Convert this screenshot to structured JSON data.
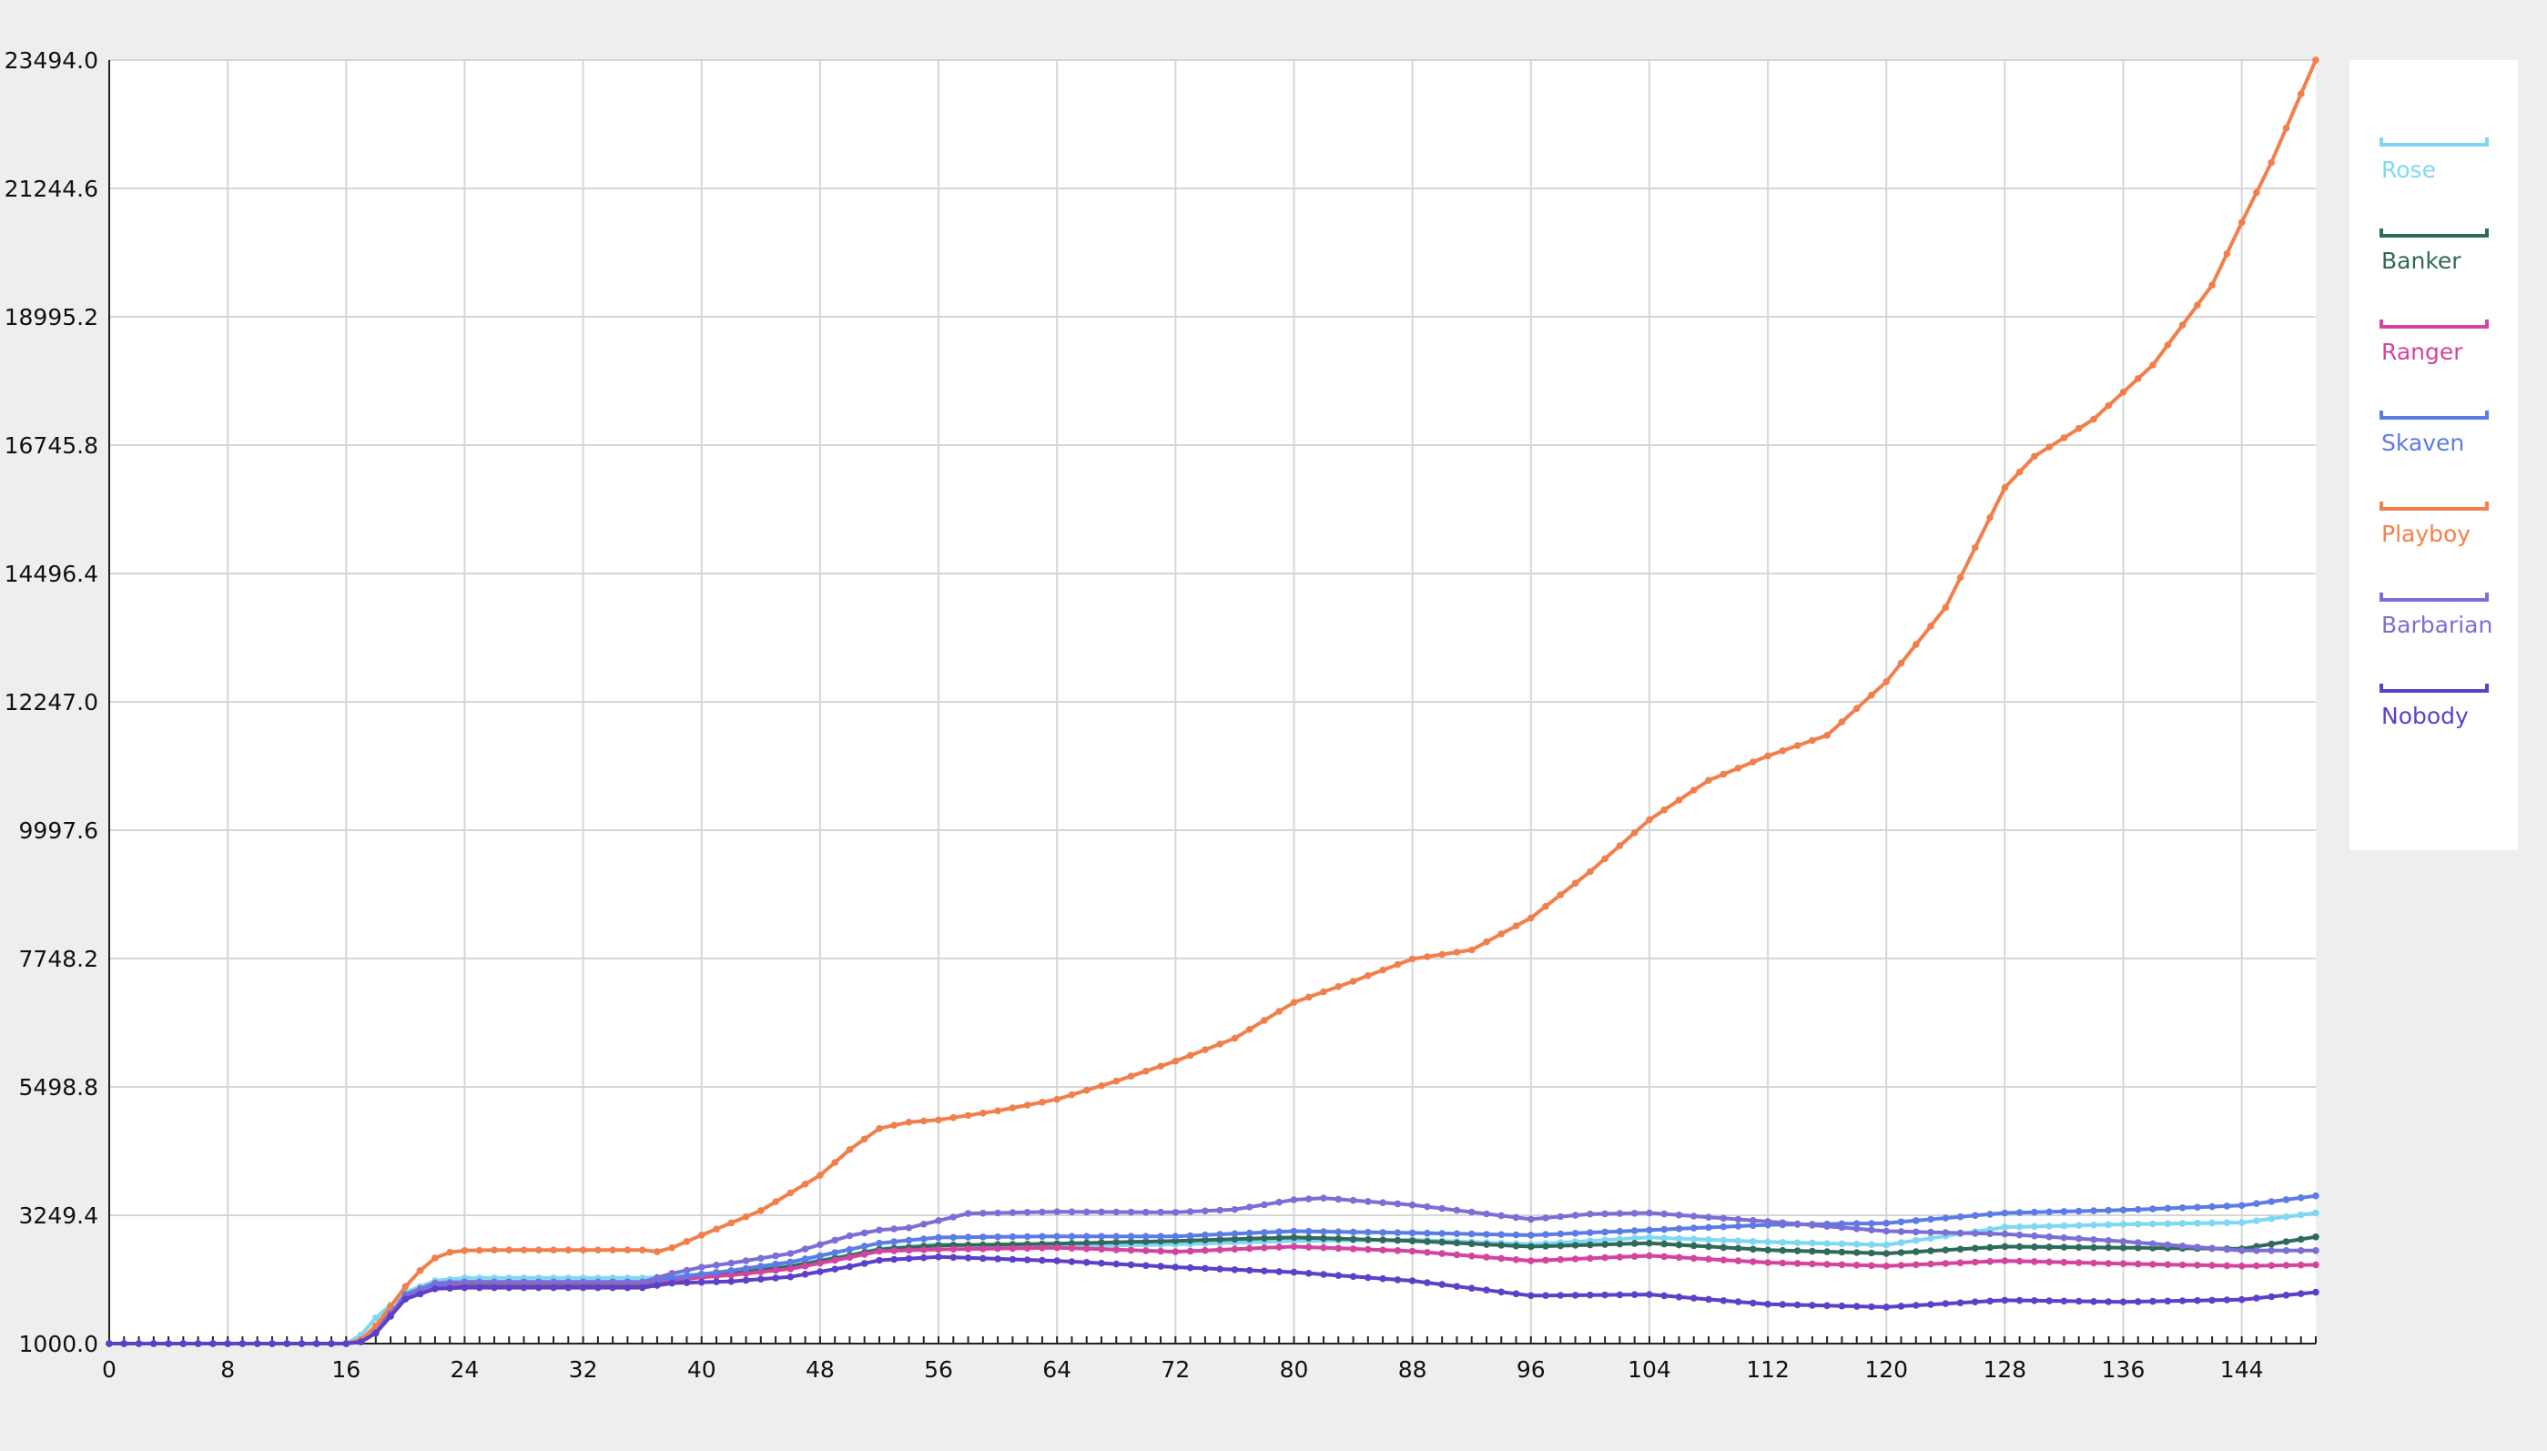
{
  "chart_data": {
    "type": "line",
    "title": "",
    "xlabel": "",
    "ylabel": "",
    "xlim": [
      0,
      149
    ],
    "ylim": [
      1000.0,
      23494.0
    ],
    "x_ticks": [
      0,
      8,
      16,
      24,
      32,
      40,
      48,
      56,
      64,
      72,
      80,
      88,
      96,
      104,
      112,
      120,
      128,
      136,
      144
    ],
    "x_tick_labels": [
      "0",
      "8",
      "16",
      "24",
      "32",
      "40",
      "48",
      "56",
      "64",
      "72",
      "80",
      "88",
      "96",
      "104",
      "112",
      "120",
      "128",
      "136",
      "144"
    ],
    "y_ticks": [
      1000.0,
      3249.4,
      5498.8,
      7748.2,
      9997.6,
      12247.0,
      14496.4,
      16745.8,
      18995.2,
      21244.6,
      23494.0
    ],
    "y_tick_labels": [
      "1000.0",
      "3249.4",
      "5498.8",
      "7748.2",
      "9997.6",
      "12247.0",
      "14496.4",
      "16745.8",
      "18995.2",
      "21244.6",
      "23494.0"
    ],
    "grid": true,
    "legend_position": "right",
    "series": [
      {
        "name": "Rose",
        "color": "#7fd8f2",
        "x": [
          0,
          16,
          17,
          18,
          20,
          22,
          24,
          36,
          38,
          42,
          46,
          50,
          52,
          56,
          64,
          72,
          80,
          88,
          96,
          104,
          112,
          120,
          128,
          136,
          144,
          149
        ],
        "values": [
          1000,
          1000,
          1150,
          1450,
          1900,
          2100,
          2150,
          2150,
          2180,
          2260,
          2380,
          2550,
          2660,
          2740,
          2700,
          2740,
          2800,
          2820,
          2740,
          2860,
          2780,
          2730,
          3040,
          3090,
          3120,
          3290
        ]
      },
      {
        "name": "Banker",
        "color": "#2f6a5a",
        "x": [
          0,
          16,
          17,
          18,
          20,
          22,
          24,
          36,
          38,
          42,
          46,
          50,
          52,
          56,
          64,
          72,
          80,
          88,
          96,
          104,
          112,
          120,
          128,
          136,
          144,
          149
        ],
        "values": [
          1000,
          1000,
          1050,
          1250,
          1800,
          2000,
          2030,
          2030,
          2100,
          2230,
          2350,
          2540,
          2650,
          2720,
          2750,
          2800,
          2860,
          2800,
          2700,
          2760,
          2640,
          2580,
          2700,
          2680,
          2660,
          2870
        ]
      },
      {
        "name": "Ranger",
        "color": "#d4449e",
        "x": [
          0,
          16,
          17,
          18,
          20,
          22,
          24,
          36,
          38,
          42,
          46,
          50,
          52,
          56,
          64,
          72,
          80,
          88,
          96,
          104,
          112,
          120,
          128,
          136,
          144,
          149
        ],
        "values": [
          1000,
          1000,
          1040,
          1230,
          1800,
          2000,
          2060,
          2060,
          2120,
          2200,
          2310,
          2510,
          2620,
          2650,
          2680,
          2610,
          2700,
          2620,
          2450,
          2540,
          2420,
          2360,
          2450,
          2400,
          2360,
          2380
        ]
      },
      {
        "name": "Skaven",
        "color": "#5b7be6",
        "x": [
          0,
          16,
          17,
          18,
          20,
          22,
          24,
          36,
          38,
          42,
          46,
          50,
          52,
          56,
          64,
          72,
          80,
          88,
          96,
          104,
          112,
          120,
          128,
          136,
          144,
          149
        ],
        "values": [
          1000,
          1000,
          1040,
          1220,
          1800,
          2020,
          2080,
          2080,
          2150,
          2280,
          2430,
          2650,
          2760,
          2860,
          2880,
          2880,
          2970,
          2940,
          2900,
          2990,
          3080,
          3110,
          3290,
          3340,
          3420,
          3590
        ]
      },
      {
        "name": "Playboy",
        "color": "#f27f4b",
        "x": [
          0,
          16,
          17,
          18,
          19,
          20,
          21,
          22,
          23,
          24,
          26,
          36,
          37,
          38,
          40,
          44,
          48,
          50,
          52,
          54,
          56,
          60,
          64,
          68,
          72,
          76,
          80,
          84,
          88,
          92,
          96,
          100,
          104,
          108,
          112,
          116,
          120,
          124,
          128,
          130,
          134,
          138,
          142,
          144,
          146,
          148,
          149
        ],
        "values": [
          1000,
          1000,
          1070,
          1310,
          1650,
          2000,
          2280,
          2500,
          2600,
          2630,
          2640,
          2640,
          2610,
          2680,
          2900,
          3330,
          3950,
          4400,
          4770,
          4880,
          4920,
          5080,
          5280,
          5600,
          5950,
          6350,
          6980,
          7350,
          7740,
          7900,
          8460,
          9270,
          10180,
          10870,
          11300,
          11660,
          12600,
          13900,
          16000,
          16550,
          17200,
          18150,
          19550,
          20650,
          21700,
          22900,
          23494
        ]
      },
      {
        "name": "Barbarian",
        "color": "#7b6fd6",
        "x": [
          0,
          16,
          17,
          18,
          20,
          22,
          24,
          36,
          38,
          40,
          42,
          46,
          50,
          52,
          54,
          58,
          64,
          72,
          76,
          80,
          82,
          88,
          96,
          100,
          104,
          112,
          120,
          128,
          136,
          144,
          149
        ],
        "values": [
          1000,
          1000,
          1030,
          1190,
          1860,
          2060,
          2080,
          2080,
          2230,
          2340,
          2410,
          2580,
          2890,
          2990,
          3030,
          3280,
          3310,
          3300,
          3350,
          3520,
          3550,
          3430,
          3180,
          3270,
          3290,
          3140,
          2970,
          2920,
          2790,
          2630,
          2630
        ]
      },
      {
        "name": "Nobody",
        "color": "#5d3fc9",
        "x": [
          0,
          16,
          17,
          18,
          20,
          22,
          24,
          36,
          38,
          42,
          46,
          50,
          52,
          56,
          64,
          72,
          80,
          88,
          96,
          104,
          112,
          120,
          128,
          136,
          144,
          149
        ],
        "values": [
          1000,
          1000,
          1030,
          1180,
          1780,
          1960,
          1980,
          1980,
          2060,
          2090,
          2170,
          2350,
          2460,
          2520,
          2450,
          2340,
          2250,
          2100,
          1840,
          1860,
          1690,
          1640,
          1760,
          1730,
          1770,
          1900
        ]
      }
    ]
  }
}
